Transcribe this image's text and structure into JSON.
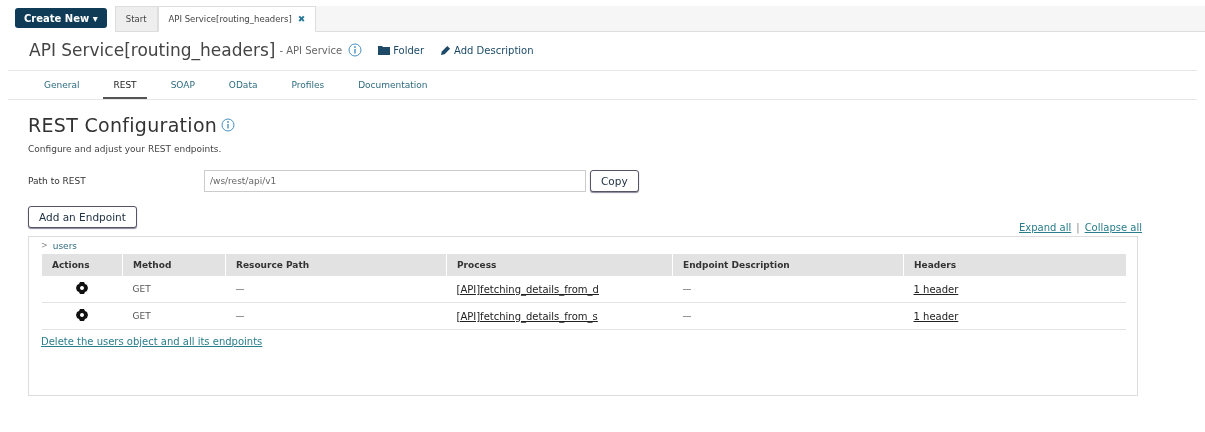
{
  "top_bar": {
    "create_button": "Create New ▾",
    "tabs": [
      {
        "label": "Start",
        "selected": false
      },
      {
        "label": "API Service[routing_headers]",
        "selected": true,
        "close": "✖"
      }
    ]
  },
  "header": {
    "title": "API Service[routing_headers]",
    "subtitle": "- API Service",
    "folder": "Folder",
    "add_description": "Add Description"
  },
  "tabs": [
    {
      "label": "General",
      "selected": false
    },
    {
      "label": "REST",
      "selected": true
    },
    {
      "label": "SOAP",
      "selected": false
    },
    {
      "label": "OData",
      "selected": false
    },
    {
      "label": "Profiles",
      "selected": false
    },
    {
      "label": "Documentation",
      "selected": false
    }
  ],
  "rest": {
    "heading": "REST Configuration",
    "description": "Configure and adjust your REST endpoints.",
    "path_label": "Path to REST",
    "path_value": "/ws/rest/api/v1",
    "copy_button": "Copy",
    "add_endpoint_button": "Add an Endpoint",
    "expand_all": "Expand all",
    "separator": "|",
    "collapse_all": "Collapse all"
  },
  "object": {
    "toggle": ">",
    "name": "users",
    "columns": [
      "Actions",
      "Method",
      "Resource Path",
      "Process",
      "Endpoint Description",
      "Headers"
    ],
    "rows": [
      {
        "method": "GET",
        "resource_path": "—",
        "process": "[API]fetching_details_from_d",
        "description": "—",
        "headers": "1 header"
      },
      {
        "method": "GET",
        "resource_path": "—",
        "process": "[API]fetching_details_from_s",
        "description": "—",
        "headers": "1 header"
      }
    ],
    "delete_link": "Delete the users object and all its endpoints"
  }
}
